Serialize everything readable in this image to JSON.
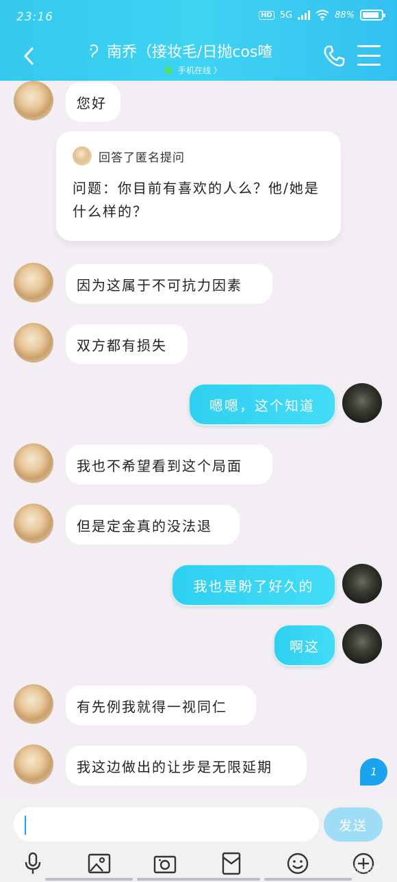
{
  "status_bar": {
    "time": "23:16",
    "hd": "HD",
    "network": "5G",
    "battery": "88%",
    "battery_level": 0.88
  },
  "header": {
    "title": "南乔（接妆毛/日抛cos喳",
    "status": "手机在线 〉"
  },
  "messages": [
    {
      "from": "them",
      "text": "您好"
    },
    {
      "from": "them",
      "type": "card",
      "card_header": "回答了匿名提问",
      "card_body": "问题：你目前有喜欢的人么？他/她是什么样的？"
    },
    {
      "from": "them",
      "text": "因为这属于不可抗力因素"
    },
    {
      "from": "them",
      "text": "双方都有损失"
    },
    {
      "from": "me",
      "text": "嗯嗯，这个知道"
    },
    {
      "from": "them",
      "text": "我也不希望看到这个局面"
    },
    {
      "from": "them",
      "text": "但是定金真的没法退"
    },
    {
      "from": "me",
      "text": "我也是盼了好久的"
    },
    {
      "from": "me",
      "text": "啊这"
    },
    {
      "from": "them",
      "text": "有先例我就得一视同仁"
    },
    {
      "from": "them",
      "text": "我这边做出的让步是无限延期"
    }
  ],
  "new_message_badge": "1",
  "composer": {
    "value": "",
    "send_label": "发送"
  },
  "toolbar": [
    "mic-icon",
    "image-icon",
    "camera-icon",
    "red-packet-icon",
    "emoji-icon",
    "plus-icon"
  ],
  "watermark": "百度贴吧",
  "colors": {
    "header": "#3fd3f3",
    "bubble_out": "#2fd0f0",
    "badge": "#1aa3ef"
  }
}
